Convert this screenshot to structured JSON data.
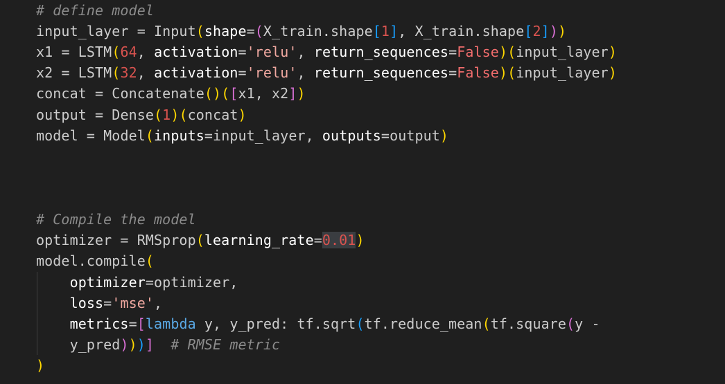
{
  "editor": {
    "lines": [
      {
        "tokens": [
          {
            "t": "# define model",
            "c": "t-comment"
          }
        ]
      },
      {
        "tokens": [
          {
            "t": "input_layer",
            "c": "t-var"
          },
          {
            "t": " = ",
            "c": "t-op"
          },
          {
            "t": "Input",
            "c": "t-var"
          },
          {
            "t": "(",
            "c": "b1"
          },
          {
            "t": "shape",
            "c": "t-param"
          },
          {
            "t": "=",
            "c": "t-op"
          },
          {
            "t": "(",
            "c": "b2"
          },
          {
            "t": "X_train.shape",
            "c": "t-var"
          },
          {
            "t": "[",
            "c": "b3"
          },
          {
            "t": "1",
            "c": "t-num"
          },
          {
            "t": "]",
            "c": "b3"
          },
          {
            "t": ", X_train.shape",
            "c": "t-var"
          },
          {
            "t": "[",
            "c": "b3"
          },
          {
            "t": "2",
            "c": "t-num"
          },
          {
            "t": "]",
            "c": "b3"
          },
          {
            "t": ")",
            "c": "b2"
          },
          {
            "t": ")",
            "c": "b1"
          }
        ]
      },
      {
        "tokens": [
          {
            "t": "x1",
            "c": "t-var"
          },
          {
            "t": " = ",
            "c": "t-op"
          },
          {
            "t": "LSTM",
            "c": "t-var"
          },
          {
            "t": "(",
            "c": "b1"
          },
          {
            "t": "64",
            "c": "t-num"
          },
          {
            "t": ", ",
            "c": "t-op"
          },
          {
            "t": "activation",
            "c": "t-param"
          },
          {
            "t": "=",
            "c": "t-op"
          },
          {
            "t": "'relu'",
            "c": "t-str"
          },
          {
            "t": ", ",
            "c": "t-op"
          },
          {
            "t": "return_sequences",
            "c": "t-param"
          },
          {
            "t": "=",
            "c": "t-op"
          },
          {
            "t": "False",
            "c": "t-kw"
          },
          {
            "t": ")",
            "c": "b1"
          },
          {
            "t": "(",
            "c": "b1"
          },
          {
            "t": "input_layer",
            "c": "t-var"
          },
          {
            "t": ")",
            "c": "b1"
          }
        ]
      },
      {
        "tokens": [
          {
            "t": "x2",
            "c": "t-var"
          },
          {
            "t": " = ",
            "c": "t-op"
          },
          {
            "t": "LSTM",
            "c": "t-var"
          },
          {
            "t": "(",
            "c": "b1"
          },
          {
            "t": "32",
            "c": "t-num"
          },
          {
            "t": ", ",
            "c": "t-op"
          },
          {
            "t": "activation",
            "c": "t-param"
          },
          {
            "t": "=",
            "c": "t-op"
          },
          {
            "t": "'relu'",
            "c": "t-str"
          },
          {
            "t": ", ",
            "c": "t-op"
          },
          {
            "t": "return_sequences",
            "c": "t-param"
          },
          {
            "t": "=",
            "c": "t-op"
          },
          {
            "t": "False",
            "c": "t-kw"
          },
          {
            "t": ")",
            "c": "b1"
          },
          {
            "t": "(",
            "c": "b1"
          },
          {
            "t": "input_layer",
            "c": "t-var"
          },
          {
            "t": ")",
            "c": "b1"
          }
        ]
      },
      {
        "tokens": [
          {
            "t": "concat",
            "c": "t-var"
          },
          {
            "t": " = ",
            "c": "t-op"
          },
          {
            "t": "Concatenate",
            "c": "t-var"
          },
          {
            "t": "()",
            "c": "b1"
          },
          {
            "t": "(",
            "c": "b1"
          },
          {
            "t": "[",
            "c": "b2"
          },
          {
            "t": "x1, x2",
            "c": "t-var"
          },
          {
            "t": "]",
            "c": "b2"
          },
          {
            "t": ")",
            "c": "b1"
          }
        ]
      },
      {
        "tokens": [
          {
            "t": "output",
            "c": "t-var"
          },
          {
            "t": " = ",
            "c": "t-op"
          },
          {
            "t": "Dense",
            "c": "t-var"
          },
          {
            "t": "(",
            "c": "b1"
          },
          {
            "t": "1",
            "c": "t-num"
          },
          {
            "t": ")",
            "c": "b1"
          },
          {
            "t": "(",
            "c": "b1"
          },
          {
            "t": "concat",
            "c": "t-var"
          },
          {
            "t": ")",
            "c": "b1"
          }
        ]
      },
      {
        "tokens": [
          {
            "t": "model",
            "c": "t-var"
          },
          {
            "t": " = ",
            "c": "t-op"
          },
          {
            "t": "Model",
            "c": "t-var"
          },
          {
            "t": "(",
            "c": "b1"
          },
          {
            "t": "inputs",
            "c": "t-param"
          },
          {
            "t": "=",
            "c": "t-op"
          },
          {
            "t": "input_layer",
            "c": "t-var"
          },
          {
            "t": ", ",
            "c": "t-op"
          },
          {
            "t": "outputs",
            "c": "t-param"
          },
          {
            "t": "=",
            "c": "t-op"
          },
          {
            "t": "output",
            "c": "t-var"
          },
          {
            "t": ")",
            "c": "b1"
          }
        ]
      },
      {
        "tokens": []
      },
      {
        "tokens": []
      },
      {
        "tokens": []
      },
      {
        "tokens": [
          {
            "t": "# Compile the model",
            "c": "t-comment"
          }
        ]
      },
      {
        "tokens": [
          {
            "t": "optimizer",
            "c": "t-var"
          },
          {
            "t": " = ",
            "c": "t-op"
          },
          {
            "t": "RMSprop",
            "c": "t-var"
          },
          {
            "t": "(",
            "c": "b1"
          },
          {
            "t": "learning_rate",
            "c": "t-param"
          },
          {
            "t": "=",
            "c": "t-op"
          },
          {
            "t": "0.01",
            "c": "t-num hl-sel"
          },
          {
            "t": ")",
            "c": "b1"
          }
        ]
      },
      {
        "tokens": [
          {
            "t": "model.compile",
            "c": "t-var"
          },
          {
            "t": "(",
            "c": "b1"
          }
        ]
      },
      {
        "tokens": [
          {
            "t": "    ",
            "c": "t-op"
          },
          {
            "t": "optimizer",
            "c": "t-param"
          },
          {
            "t": "=",
            "c": "t-op"
          },
          {
            "t": "optimizer,",
            "c": "t-var"
          }
        ]
      },
      {
        "tokens": [
          {
            "t": "    ",
            "c": "t-op"
          },
          {
            "t": "loss",
            "c": "t-param"
          },
          {
            "t": "=",
            "c": "t-op"
          },
          {
            "t": "'mse'",
            "c": "t-str"
          },
          {
            "t": ",",
            "c": "t-op"
          }
        ]
      },
      {
        "tokens": [
          {
            "t": "    ",
            "c": "t-op"
          },
          {
            "t": "metrics",
            "c": "t-param"
          },
          {
            "t": "=",
            "c": "t-op"
          },
          {
            "t": "[",
            "c": "b2"
          },
          {
            "t": "lambda",
            "c": "t-lambda"
          },
          {
            "t": " y, y_pred: tf.sqrt",
            "c": "t-var"
          },
          {
            "t": "(",
            "c": "b3"
          },
          {
            "t": "tf.reduce_mean",
            "c": "t-var"
          },
          {
            "t": "(",
            "c": "b1"
          },
          {
            "t": "tf.square",
            "c": "t-var"
          },
          {
            "t": "(",
            "c": "b2"
          },
          {
            "t": "y -",
            "c": "t-var"
          }
        ]
      },
      {
        "tokens": [
          {
            "t": "    ",
            "c": "t-op"
          },
          {
            "t": "y_pred",
            "c": "t-var"
          },
          {
            "t": ")",
            "c": "b2"
          },
          {
            "t": ")",
            "c": "b1"
          },
          {
            "t": ")",
            "c": "b3"
          },
          {
            "t": "]",
            "c": "b2"
          },
          {
            "t": "  ",
            "c": "t-op"
          },
          {
            "t": "# RMSE metric",
            "c": "t-comment"
          }
        ]
      },
      {
        "tokens": [
          {
            "t": ")",
            "c": "b1"
          }
        ]
      }
    ]
  }
}
